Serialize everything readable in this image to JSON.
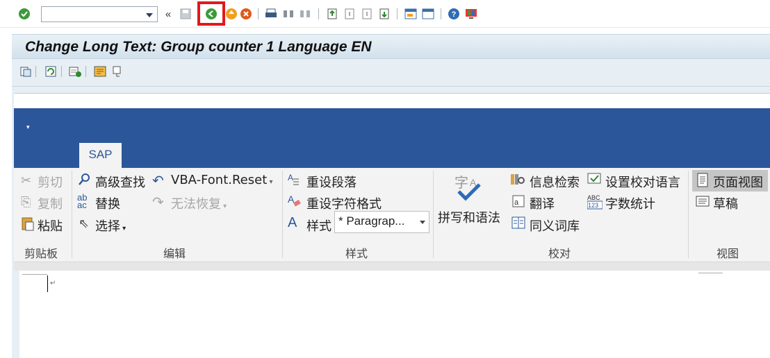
{
  "sap_toolbar": {
    "command_field_value": "",
    "collapse_glyph": "«",
    "highlight_color": "#e0191e"
  },
  "title_bar": {
    "title": "Change Long Text: Group counter 1 Language EN"
  },
  "word": {
    "qat_glyph": "▾",
    "tab_label": "SAP",
    "ribbon": {
      "clipboard": {
        "cut": "剪切",
        "copy": "复制",
        "paste": "粘贴",
        "group_label": "剪贴板"
      },
      "edit": {
        "advanced_find": "高级查找",
        "replace": "替换",
        "select": "选择",
        "vba_font_reset": "VBA-Font.Reset",
        "cannot_undo": "无法恢复",
        "group_label": "编辑"
      },
      "styles": {
        "reset_paragraph": "重设段落",
        "reset_char_format": "重设字符格式",
        "styles_label": "样式",
        "style_value": "* Paragrap...",
        "group_label": "样式"
      },
      "proofing": {
        "spelling_grammar": "拼写和语法",
        "research": "信息检索",
        "translate": "翻译",
        "thesaurus": "同义词库",
        "set_language": "设置校对语言",
        "word_count": "字数统计",
        "group_label": "校对"
      },
      "view": {
        "page_view": "页面视图",
        "draft": "草稿",
        "group_label": "视图"
      }
    },
    "paragraph_mark": "↵"
  }
}
